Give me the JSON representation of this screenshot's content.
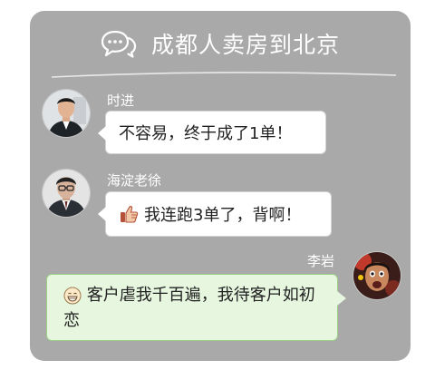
{
  "group": {
    "title": "成都人卖房到北京"
  },
  "messages": [
    {
      "sender": "时进",
      "text": "不容易，终于成了1单！",
      "icon": "none",
      "side": "left"
    },
    {
      "sender": "海淀老徐",
      "text": "我连跑3单了，背啊！",
      "icon": "thumbs-up-icon",
      "side": "left"
    },
    {
      "sender": "李岩",
      "text": "客户虐我千百遍，我待客户如初恋",
      "icon": "grinning-face-icon",
      "side": "right"
    }
  ],
  "colors": {
    "card_background": "#a9a9a9",
    "incoming_bubble": "#ffffff",
    "outgoing_bubble": "#e6f6df",
    "outgoing_border": "#9ccf86"
  }
}
